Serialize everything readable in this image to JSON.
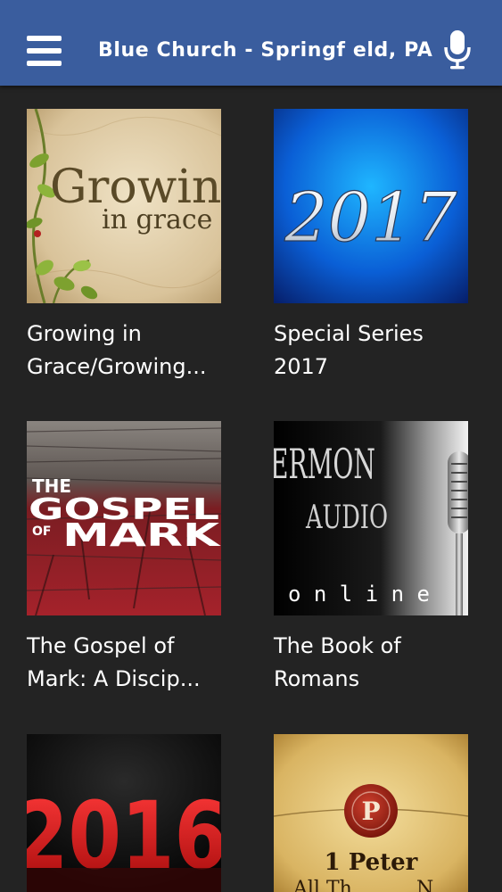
{
  "header": {
    "title": "Blue Church - Springf eld, PA",
    "menu_icon": "hamburger-menu-icon",
    "mic_icon": "microphone-icon",
    "background": "#3a5d9e"
  },
  "series": [
    {
      "title": "Growing in\nGrace/Growing...",
      "art": {
        "line1": "Growin",
        "line2": "in grace"
      }
    },
    {
      "title": "Special Series\n2017",
      "art": {
        "year": "2017"
      }
    },
    {
      "title": "The Gospel of\nMark: A Discip...",
      "art": {
        "line1": "THE",
        "line2": "GOSPEL",
        "line3": "OF",
        "line4": "MARK"
      }
    },
    {
      "title": "The Book of\nRomans",
      "art": {
        "line1": "ERMON",
        "line2": "AUDIO",
        "line3": "o n l i n e"
      }
    },
    {
      "title": "",
      "art": {
        "year": "2016"
      }
    },
    {
      "title": "",
      "art": {
        "seal": "P",
        "line1": "1 Peter",
        "line2": "All Th",
        "line3": "N"
      }
    }
  ]
}
